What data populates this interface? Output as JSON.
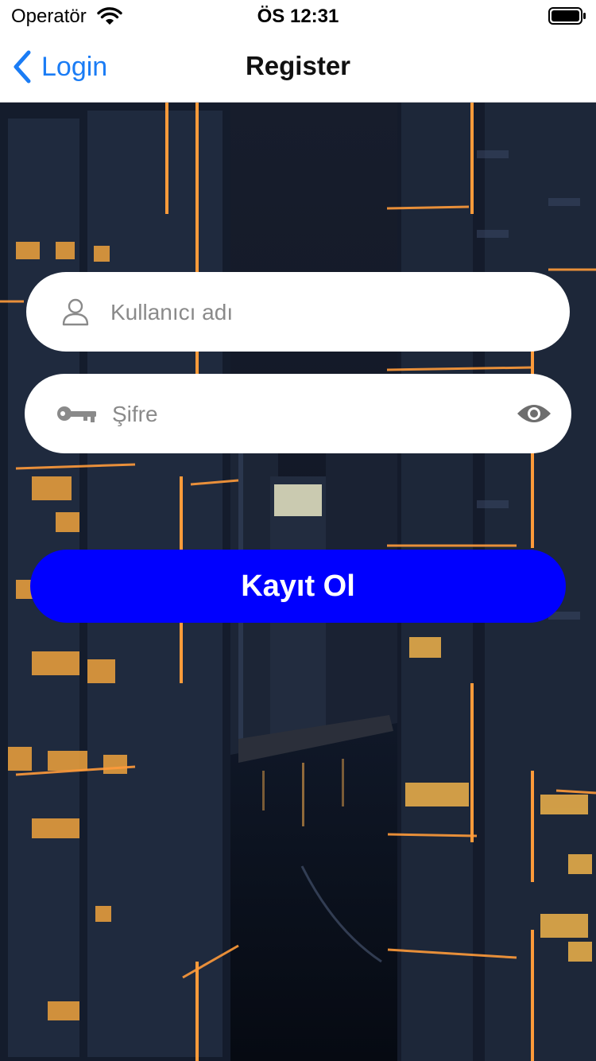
{
  "status_bar": {
    "carrier": "Operatör",
    "time": "ÖS 12:31"
  },
  "nav": {
    "back_label": "Login",
    "title": "Register"
  },
  "form": {
    "username": {
      "placeholder": "Kullanıcı adı",
      "value": "",
      "icon": "person-icon"
    },
    "password": {
      "placeholder": "Şifre",
      "value": "",
      "icon": "key-icon",
      "toggle_icon": "eye-icon"
    },
    "submit_label": "Kayıt Ol"
  },
  "colors": {
    "accent": "#1a7cf5",
    "button": "#0000ff",
    "button_text": "#ffffff"
  }
}
